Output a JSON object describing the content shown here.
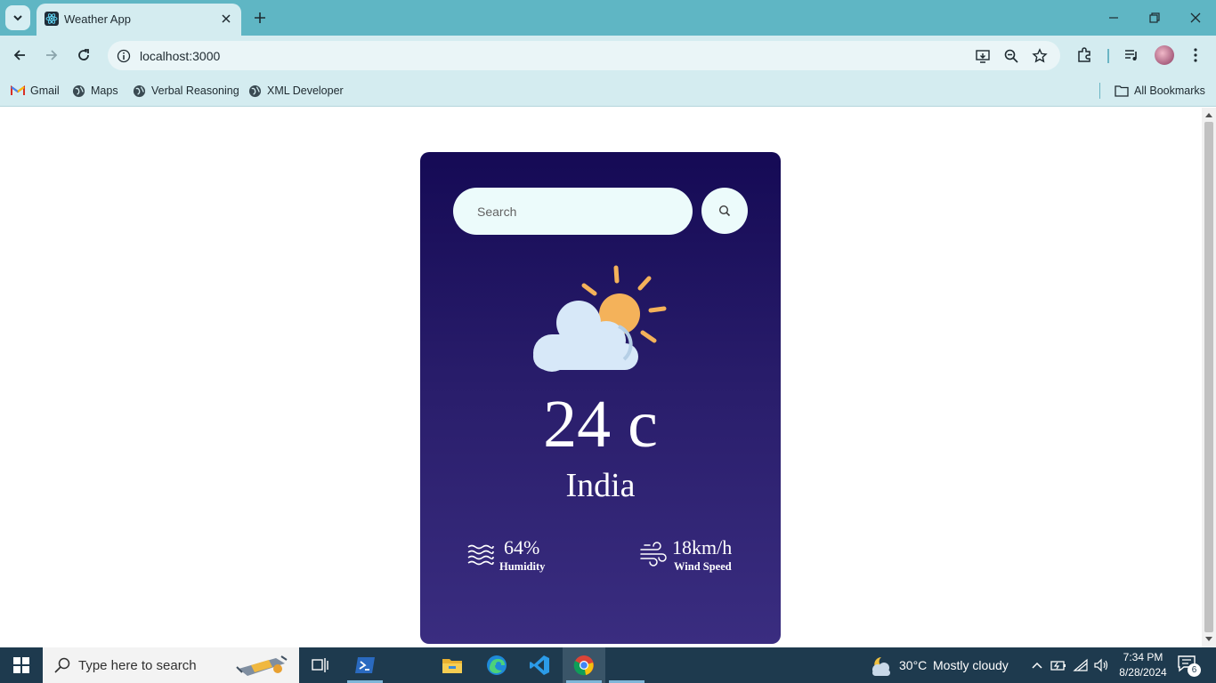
{
  "browser": {
    "tab": {
      "title": "Weather App",
      "favicon": "react-icon"
    },
    "address": "localhost:3000",
    "bookmarks": [
      {
        "label": "Gmail",
        "icon": "gmail-icon"
      },
      {
        "label": "Maps",
        "icon": "globe-icon"
      },
      {
        "label": "Verbal Reasoning",
        "icon": "globe-icon"
      },
      {
        "label": "XML Developer",
        "icon": "globe-icon"
      }
    ],
    "all_bookmarks": "All Bookmarks"
  },
  "app": {
    "search_placeholder": "Search",
    "weather_icon": "partly-cloudy-icon",
    "temperature": "24 c",
    "city": "India",
    "humidity": {
      "value": "64%",
      "label": "Humidity",
      "icon": "humidity-waves-icon"
    },
    "wind": {
      "value": "18km/h",
      "label": "Wind Speed",
      "icon": "wind-icon"
    },
    "colors": {
      "card_top": "#150a55",
      "card_bottom": "#3a2d80",
      "input_bg": "#ecfbfb",
      "sun": "#f4b25a",
      "cloud": "#d7e8f8"
    }
  },
  "taskbar": {
    "search_placeholder": "Type here to search",
    "apps": [
      "task-view-icon",
      "powershell-icon",
      "file-explorer-icon",
      "edge-icon",
      "vscode-icon",
      "chrome-icon"
    ],
    "weather_temp": "30°C",
    "weather_desc": "Mostly cloudy",
    "time": "7:34 PM",
    "date": "8/28/2024",
    "notification_count": "6"
  }
}
